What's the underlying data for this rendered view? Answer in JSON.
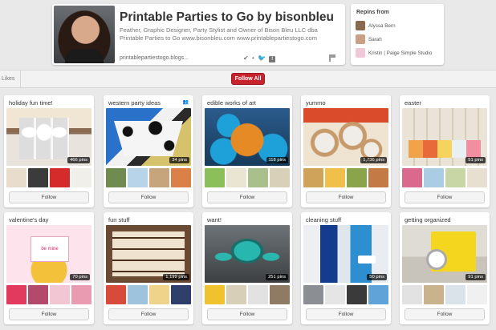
{
  "profile": {
    "name": "Printable Parties to Go by bisonbleu",
    "bio": "Feather, Graphic Designer, Party Stylist and Owner of Bison Bleu LLC dba Printable Parties to Go www.bisonbleu.com www.printablepartiestogo.com",
    "url": "printablepartiestogo.blogs...",
    "icons": [
      "check-icon",
      "twitter-icon",
      "facebook-icon",
      "flag-icon"
    ]
  },
  "repins": {
    "title": "Repins from",
    "people": [
      {
        "name": "Alyssa Bern",
        "color": "#8a6a4e"
      },
      {
        "name": "Sarah",
        "color": "#c9a084"
      },
      {
        "name": "Kristin | Paige Simple Studio",
        "color": "#f1c8d8"
      }
    ]
  },
  "actions": {
    "likes": "Likes",
    "follow_all": "Follow All"
  },
  "colors": {
    "accent": "#c8232c",
    "background": "#e9e9e9"
  },
  "boards": [
    {
      "title": "holiday fun time!",
      "pins": "466 pins",
      "follow": "Follow",
      "cover": "c-holiday",
      "thumbs": [
        "#e8dccd",
        "#3b3b3b",
        "#d52b2b",
        "#f0efe9"
      ]
    },
    {
      "title": "western party ideas",
      "pins": "34 pins",
      "follow": "Follow",
      "cover": "c-western",
      "collab": true,
      "thumbs": [
        "#6f8b4f",
        "#b8d4e8",
        "#c6a57c",
        "#db8048"
      ]
    },
    {
      "title": "edible works of art",
      "pins": "118 pins",
      "follow": "Follow",
      "cover": "c-art",
      "thumbs": [
        "#8bbf5a",
        "#eae4d2",
        "#a9c08d",
        "#d9d0b9"
      ]
    },
    {
      "title": "yummo",
      "pins": "1,736 pins",
      "follow": "Follow",
      "cover": "c-yummo",
      "thumbs": [
        "#cfa45a",
        "#f0c04a",
        "#8aa44b",
        "#c47a44"
      ]
    },
    {
      "title": "easter",
      "pins": "51 pins",
      "follow": "Follow",
      "cover": "c-easter",
      "thumbs": [
        "#d96a8e",
        "#aacde3",
        "#c8d5a4",
        "#e7dfd0"
      ]
    },
    {
      "title": "valentine's day",
      "pins": "70 pins",
      "follow": "Follow",
      "cover": "c-valentine",
      "thumbs": [
        "#e23a5e",
        "#b44a6b",
        "#f2c6d3",
        "#e99bb1"
      ]
    },
    {
      "title": "fun stuff",
      "pins": "1,199 pins",
      "follow": "Follow",
      "cover": "c-fun",
      "thumbs": [
        "#d84a3a",
        "#9ec4dd",
        "#f0d38b",
        "#2e3f6b"
      ]
    },
    {
      "title": "want!",
      "pins": "251 pins",
      "follow": "Follow",
      "cover": "c-want",
      "thumbs": [
        "#f0c22f",
        "#d8cfb8",
        "#e2e2e2",
        "#8f7a63"
      ]
    },
    {
      "title": "cleaning stuff",
      "pins": "50 pins",
      "follow": "Follow",
      "cover": "c-clean",
      "thumbs": [
        "#8b8e92",
        "#e5e5e5",
        "#3a3a3a",
        "#5fa3d8"
      ]
    },
    {
      "title": "getting organized",
      "pins": "91 pins",
      "follow": "Follow",
      "cover": "c-organized",
      "thumbs": [
        "#e2e2e2",
        "#c9b38d",
        "#dbe3ea",
        "#f0f0f0"
      ]
    }
  ]
}
